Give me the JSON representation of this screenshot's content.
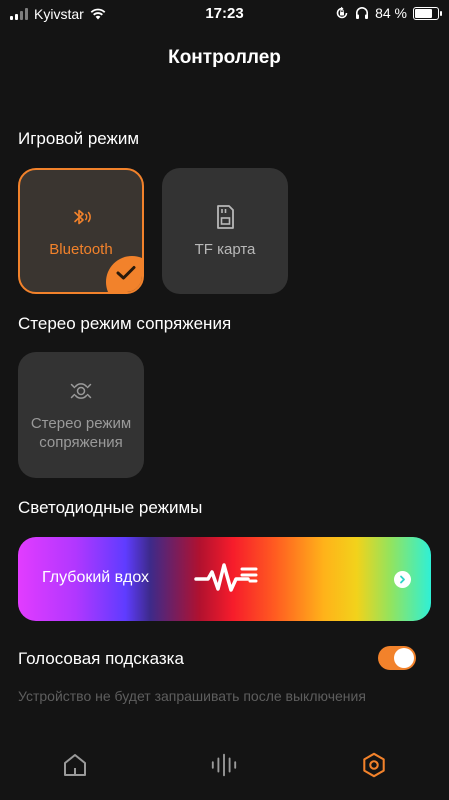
{
  "status_bar": {
    "carrier": "Kyivstar",
    "time": "17:23",
    "battery_percent": "84 %",
    "battery_level": 0.84
  },
  "header": {
    "title": "Контроллер"
  },
  "game_mode": {
    "section_label": "Игровой режим",
    "options": [
      {
        "label": "Bluetooth",
        "icon": "bluetooth-icon",
        "selected": true
      },
      {
        "label": "TF карта",
        "icon": "sd-card-icon",
        "selected": false
      }
    ]
  },
  "stereo_pairing": {
    "section_label": "Стерео режим сопряжения",
    "tile_label": "Стерео режим сопряжения",
    "icon": "stereo-pairing-icon"
  },
  "led_modes": {
    "section_label": "Светодиодные режимы",
    "current_mode": "Глубокий вдох",
    "icon": "heartbeat-wave-icon"
  },
  "voice_prompt": {
    "label": "Голосовая подсказка",
    "enabled": true,
    "hint": "Устройство не будет запрашивать после выключения"
  },
  "bottom_nav": {
    "items": [
      {
        "icon": "home-icon",
        "active": false
      },
      {
        "icon": "equalizer-icon",
        "active": false
      },
      {
        "icon": "settings-hex-icon",
        "active": true
      }
    ]
  },
  "colors": {
    "accent": "#f2822b",
    "background": "#141414",
    "tile": "#333333",
    "inactive_icon": "#9a9a9a"
  }
}
